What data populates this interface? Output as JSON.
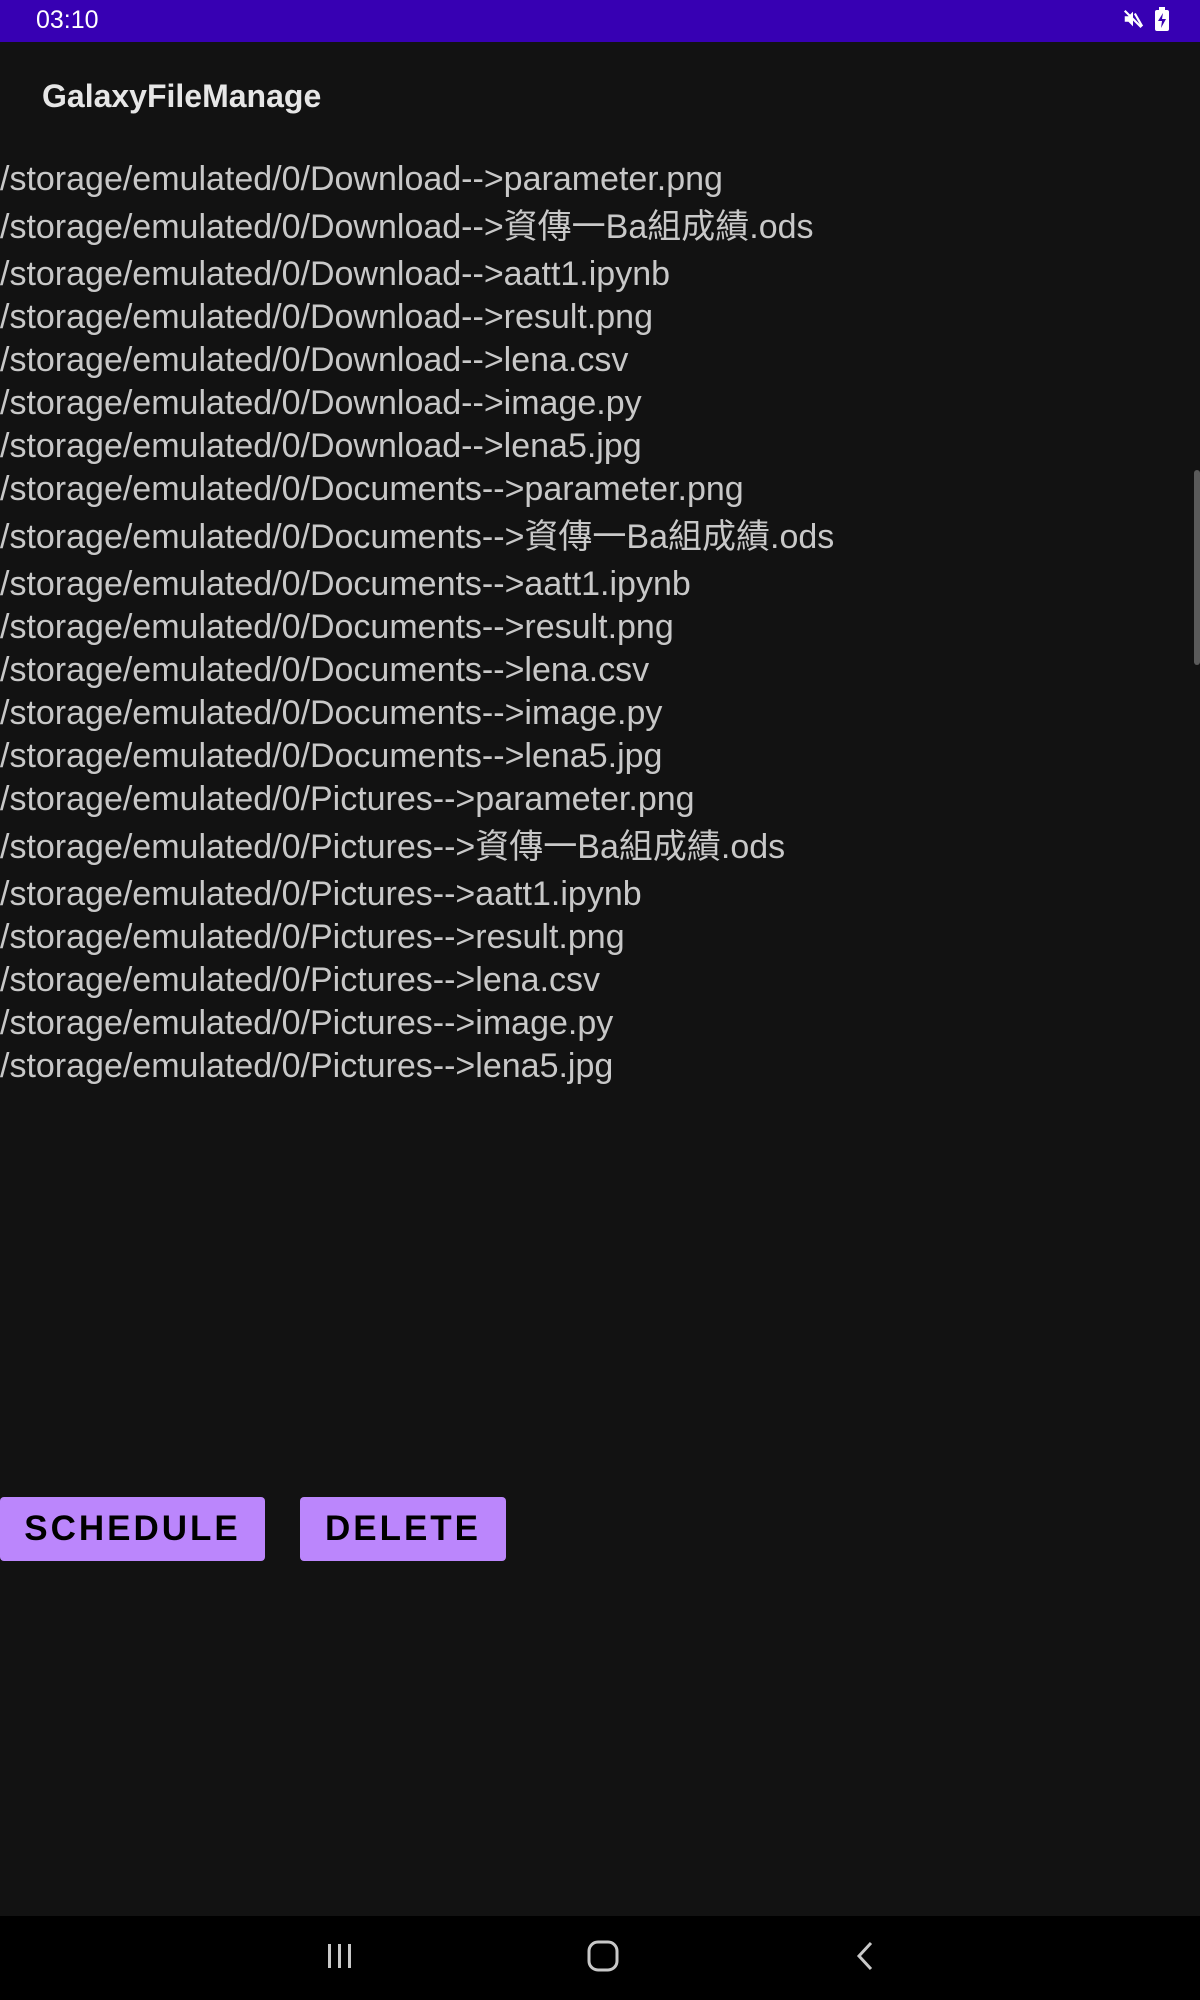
{
  "status_bar": {
    "time": "03:10",
    "icons": [
      "mute-icon",
      "battery-charging-icon"
    ]
  },
  "app": {
    "title": "GalaxyFileManage"
  },
  "files": [
    "/storage/emulated/0/Download-->parameter.png",
    "/storage/emulated/0/Download-->資傳一Ba組成績.ods",
    "/storage/emulated/0/Download-->aatt1.ipynb",
    "/storage/emulated/0/Download-->result.png",
    "/storage/emulated/0/Download-->lena.csv",
    "/storage/emulated/0/Download-->image.py",
    "/storage/emulated/0/Download-->lena5.jpg",
    "/storage/emulated/0/Documents-->parameter.png",
    "/storage/emulated/0/Documents-->資傳一Ba組成績.ods",
    "/storage/emulated/0/Documents-->aatt1.ipynb",
    "/storage/emulated/0/Documents-->result.png",
    "/storage/emulated/0/Documents-->lena.csv",
    "/storage/emulated/0/Documents-->image.py",
    "/storage/emulated/0/Documents-->lena5.jpg",
    "/storage/emulated/0/Pictures-->parameter.png",
    "/storage/emulated/0/Pictures-->資傳一Ba組成績.ods",
    "/storage/emulated/0/Pictures-->aatt1.ipynb",
    "/storage/emulated/0/Pictures-->result.png",
    "/storage/emulated/0/Pictures-->lena.csv",
    "/storage/emulated/0/Pictures-->image.py",
    "/storage/emulated/0/Pictures-->lena5.jpg"
  ],
  "buttons": {
    "schedule_label": "SCHEDULE",
    "delete_label": "DELETE"
  },
  "nav_bar": {
    "icons": [
      "recents-icon",
      "home-icon",
      "back-icon"
    ]
  },
  "colors": {
    "status_bar": "#3700b3",
    "background": "#121212",
    "button": "#bb86fc",
    "text": "#c8c8c8"
  }
}
